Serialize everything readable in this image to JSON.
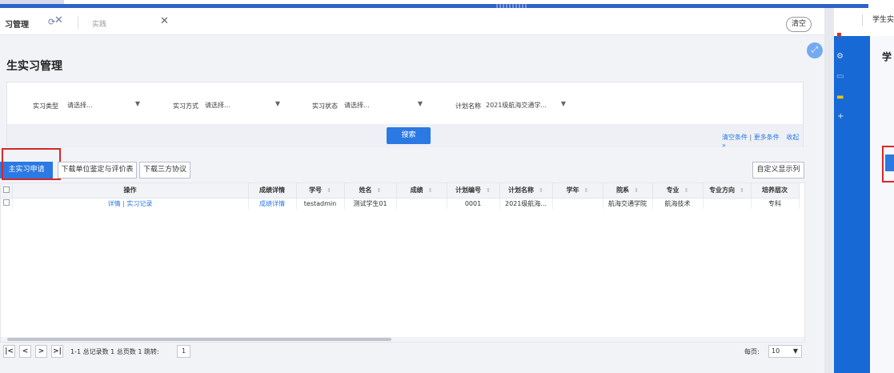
{
  "tabs": {
    "active_label": "习管理",
    "second_label": "实践",
    "clear_label": "清空"
  },
  "page": {
    "title": "生实习管理"
  },
  "filters": [
    {
      "label": "实习类型",
      "value": "请选择..."
    },
    {
      "label": "实习方式",
      "value": "请选择..."
    },
    {
      "label": "实习状态",
      "value": "请选择..."
    },
    {
      "label": "计划名称",
      "value": "2021级航海交通学..."
    }
  ],
  "filter_actions": {
    "search_label": "搜索",
    "clear_conditions": "清空条件",
    "more_conditions": "更多条件",
    "collapse": "收起 »"
  },
  "toolbar": {
    "apply_label": "主实习申请",
    "download_eval_label": "下载单位鉴定与评价表",
    "download_agreement_label": "下载三方协议",
    "custom_columns_label": "自定义显示列"
  },
  "table": {
    "headers": [
      "操作",
      "成绩详情",
      "学号",
      "姓名",
      "成绩",
      "计划编号",
      "计划名称",
      "学年",
      "院系",
      "专业",
      "专业方向",
      "培养层次"
    ],
    "rows": [
      {
        "actions": "详情 | 实习记录",
        "score_detail": "成绩详情",
        "student_no": "testadmin",
        "name": "测试学生01",
        "score": "",
        "plan_no": "0001",
        "plan_name": "2021级航海...",
        "year": "",
        "dept": "航海交通学院",
        "major": "航海技术",
        "direction": "",
        "level": "专科"
      }
    ]
  },
  "pager": {
    "info": "1-1 总记录数 1 总页数 1 跳转:",
    "jump_value": "1",
    "page_size_label": "每页:",
    "page_size": "10"
  },
  "right_panel": {
    "top_label": "学生实",
    "title": "学"
  },
  "colors": {
    "primary": "#2b79e3",
    "highlight": "#d62828",
    "topbar": "#2f62c9"
  }
}
